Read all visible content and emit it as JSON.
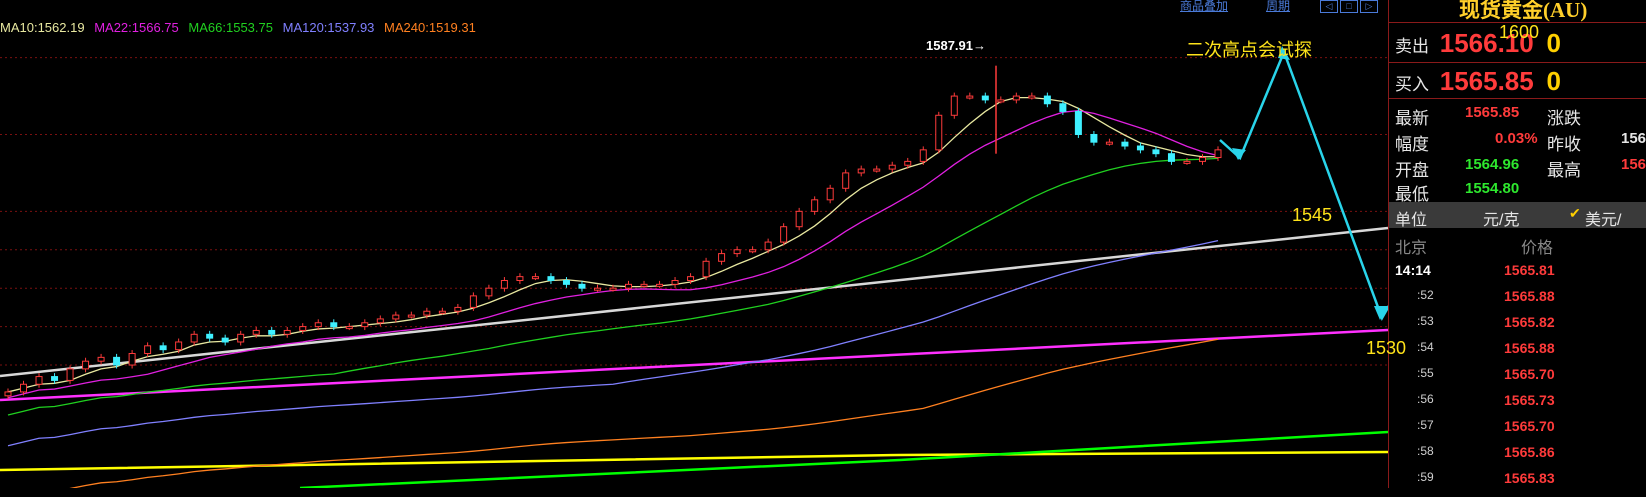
{
  "ma_legend": [
    {
      "label": "MA10:1562.19",
      "color": "#e8e8a0"
    },
    {
      "label": "MA22:1566.75",
      "color": "#e020e0"
    },
    {
      "label": "MA66:1553.75",
      "color": "#20d020"
    },
    {
      "label": "MA120:1537.93",
      "color": "#8080ff"
    },
    {
      "label": "MA240:1519.31",
      "color": "#ff8020"
    }
  ],
  "toolbar": {
    "overlay_label": "商品叠加",
    "period_label": "周期"
  },
  "chart_data": {
    "type": "candlestick",
    "instrument": "现货黄金(AU)",
    "peak_label": "1587.91→",
    "annotation": "二次高点会试探",
    "projection_labels": {
      "p1545": "1545",
      "p1530": "1530",
      "p1600": "1600"
    },
    "closes": [
      1503,
      1505,
      1507,
      1506,
      1509,
      1511,
      1512,
      1510,
      1513,
      1515,
      1514,
      1516,
      1518,
      1517,
      1516,
      1518,
      1519,
      1518,
      1519,
      1520,
      1521,
      1520,
      1520,
      1521,
      1522,
      1523,
      1523,
      1524,
      1524,
      1525,
      1528,
      1530,
      1532,
      1533,
      1533,
      1532,
      1531,
      1530,
      1530,
      1530,
      1531,
      1531,
      1531,
      1532,
      1533,
      1537,
      1539,
      1540,
      1540,
      1542,
      1546,
      1550,
      1553,
      1556,
      1560,
      1561,
      1561,
      1562,
      1563,
      1566,
      1575,
      1580,
      1580,
      1579,
      1579,
      1580,
      1580,
      1578,
      1576,
      1570,
      1568,
      1568,
      1567,
      1566,
      1565,
      1563,
      1563,
      1564,
      1566
    ]
  },
  "panel": {
    "title": "现货黄金(AU)",
    "sell_label": "卖出",
    "sell_value": "1566.10",
    "sell_qty": "0",
    "buy_label": "买入",
    "buy_value": "1565.85",
    "buy_qty": "0",
    "latest_label": "最新",
    "latest_value": "1565.85",
    "change_label": "涨跌",
    "amp_label": "幅度",
    "amp_value": "0.03%",
    "prev_label": "昨收",
    "prev_value": "156",
    "open_label": "开盘",
    "open_value": "1564.96",
    "high_label": "最高",
    "high_value": "156",
    "low_label": "最低",
    "low_value": "1554.80",
    "unit_label": "单位",
    "unit_value": "元/克",
    "alt_unit": "美元/",
    "tick_head_time": "北京",
    "tick_head_price": "价格",
    "ticks": [
      {
        "time": "14:14",
        "price": "1565.81"
      },
      {
        "time": ":52",
        "price": "1565.88"
      },
      {
        "time": ":53",
        "price": "1565.82"
      },
      {
        "time": ":54",
        "price": "1565.88"
      },
      {
        "time": ":55",
        "price": "1565.70"
      },
      {
        "time": ":56",
        "price": "1565.73"
      },
      {
        "time": ":57",
        "price": "1565.70"
      },
      {
        "time": ":58",
        "price": "1565.86"
      },
      {
        "time": ":59",
        "price": "1565.83"
      }
    ]
  }
}
